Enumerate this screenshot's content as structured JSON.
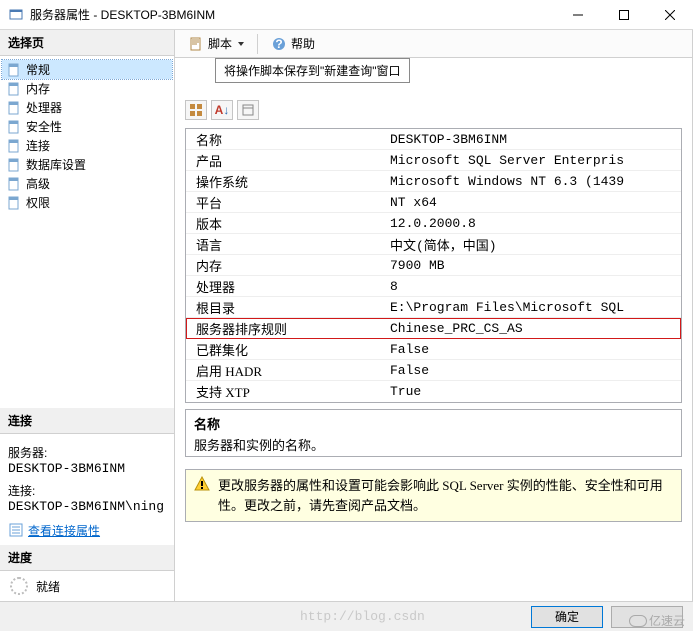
{
  "titlebar": {
    "text": "服务器属性 - DESKTOP-3BM6INM"
  },
  "left": {
    "select_page": "选择页",
    "items": [
      "常规",
      "内存",
      "处理器",
      "安全性",
      "连接",
      "数据库设置",
      "高级",
      "权限"
    ],
    "connection_header": "连接",
    "server_label": "服务器:",
    "server_value": "DESKTOP-3BM6INM",
    "conn_label": "连接:",
    "conn_value": "DESKTOP-3BM6INM\\ning",
    "view_conn_props": "查看连接属性",
    "progress_header": "进度",
    "progress_status": "就绪"
  },
  "toolbar": {
    "script": "脚本",
    "help": "帮助",
    "tooltip": "将操作脚本保存到\"新建查询\"窗口"
  },
  "props": [
    {
      "k": "名称",
      "v": "DESKTOP-3BM6INM"
    },
    {
      "k": "产品",
      "v": "Microsoft SQL Server Enterpris"
    },
    {
      "k": "操作系统",
      "v": "Microsoft Windows NT 6.3 (1439"
    },
    {
      "k": "平台",
      "v": "NT x64"
    },
    {
      "k": "版本",
      "v": "12.0.2000.8"
    },
    {
      "k": "语言",
      "v": "中文(简体，中国)"
    },
    {
      "k": "内存",
      "v": "7900 MB"
    },
    {
      "k": "处理器",
      "v": "8"
    },
    {
      "k": "根目录",
      "v": "E:\\Program Files\\Microsoft SQL"
    },
    {
      "k": "服务器排序规则",
      "v": "Chinese_PRC_CS_AS",
      "hl": true
    },
    {
      "k": "已群集化",
      "v": "False"
    },
    {
      "k": "启用 HADR",
      "v": "False"
    },
    {
      "k": "支持 XTP",
      "v": "True"
    }
  ],
  "desc": {
    "title": "名称",
    "text": "服务器和实例的名称。"
  },
  "warn": {
    "text": "更改服务器的属性和设置可能会影响此 SQL Server 实例的性能、安全性和可用性。更改之前，请先查阅产品文档。"
  },
  "footer": {
    "ok": "确定",
    "cancel": "",
    "blog": "http://blog.csdn",
    "brand": "亿速云"
  }
}
